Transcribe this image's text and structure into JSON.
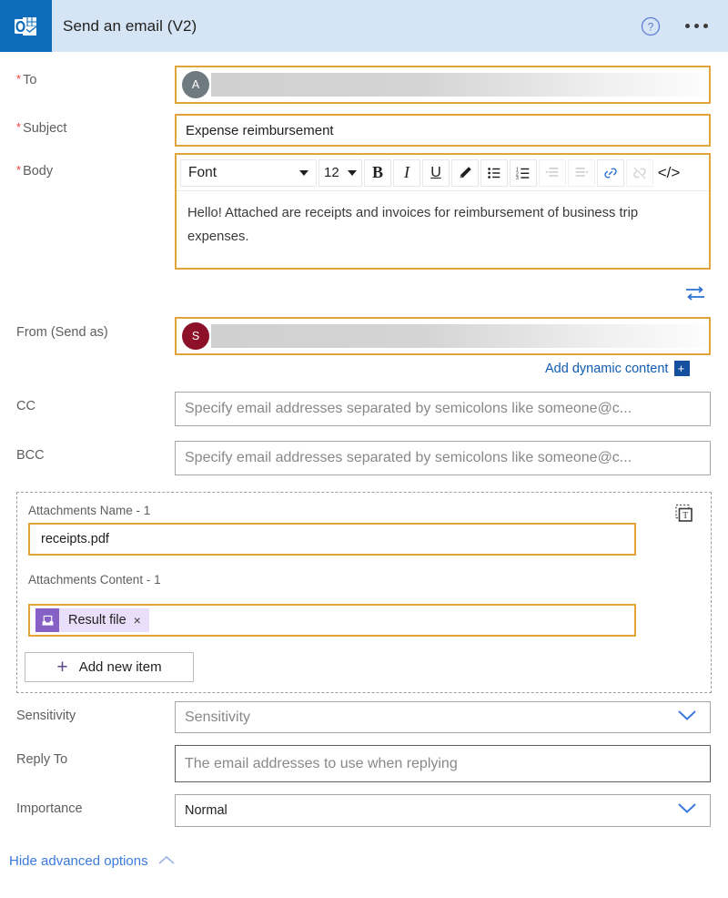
{
  "header": {
    "title": "Send an email (V2)",
    "app_icon": "outlook-icon",
    "help_icon": "help-circle-icon",
    "more_icon": "ellipsis-icon"
  },
  "fields": {
    "to": {
      "label": "To",
      "required_marker": "*",
      "avatar_initial": "A",
      "avatar_color": "#6f7a80",
      "value": ""
    },
    "subject": {
      "label": "Subject",
      "required_marker": "*",
      "value": "Expense reimbursement"
    },
    "body": {
      "label": "Body",
      "required_marker": "*",
      "value": "Hello! Attached are receipts and invoices for reimbursement of business trip expenses."
    },
    "from": {
      "label": "From (Send as)",
      "avatar_initial": "S",
      "avatar_color": "#8b1028",
      "value": ""
    },
    "cc": {
      "label": "CC",
      "placeholder": "Specify email addresses separated by semicolons like someone@c..."
    },
    "bcc": {
      "label": "BCC",
      "placeholder": "Specify email addresses separated by semicolons like someone@c..."
    },
    "sensitivity": {
      "label": "Sensitivity",
      "placeholder": "Sensitivity",
      "chevron_icon": "chevron-down-icon"
    },
    "reply_to": {
      "label": "Reply To",
      "placeholder": "The email addresses to use when replying"
    },
    "importance": {
      "label": "Importance",
      "value": "Normal",
      "chevron_icon": "chevron-down-icon"
    }
  },
  "editor_toolbar": {
    "font_label": "Font",
    "font_size": "12",
    "bold": "B",
    "italic": "I",
    "underline": "U",
    "highlighter_icon": "highlighter-pen-icon",
    "bulleted_list_icon": "bulleted-list-icon",
    "numbered_list_icon": "numbered-list-icon",
    "indent_icon": "indent-icon",
    "outdent_icon": "outdent-icon",
    "link_icon": "link-icon",
    "unlink_icon": "unlink-icon",
    "code_view": "</>"
  },
  "swap_icon": "swap-arrows-icon",
  "add_dynamic_content": {
    "label": "Add dynamic content",
    "icon": "add-plus-badge-icon"
  },
  "attachments": {
    "name_label": "Attachments Name - 1",
    "name_value": "receipts.pdf",
    "content_label": "Attachments Content - 1",
    "content_token": "Result file",
    "token_icon": "dynamic-content-file-icon",
    "token_remove": "×",
    "text_mode_icon": "switch-to-text-mode-icon",
    "add_new_item": "Add new item",
    "add_new_item_icon": "plus-icon"
  },
  "footer": {
    "hide_advanced": "Hide advanced options",
    "chevron_icon": "chevron-up-icon"
  },
  "colors": {
    "header_bg": "#d6e5f5",
    "app_icon_bg": "#0f6cbd",
    "accent_border": "#e2a33b",
    "link_blue": "#3b79dd",
    "required_red": "#e8403a",
    "token_purple": "#8661c5"
  }
}
